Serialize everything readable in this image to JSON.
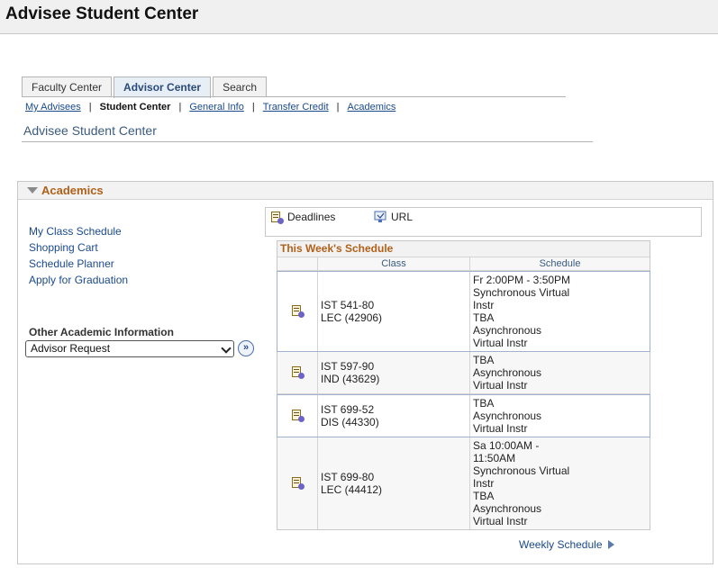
{
  "page": {
    "title": "Advisee Student Center"
  },
  "tabs": [
    {
      "label": "Faculty Center"
    },
    {
      "label": "Advisor Center"
    },
    {
      "label": "Search"
    }
  ],
  "subnav": {
    "items": [
      "My Advisees",
      "Student Center",
      "General Info",
      "Transfer Credit",
      "Academics"
    ],
    "separator": "|"
  },
  "content": {
    "heading": "Advisee Student Center"
  },
  "academics": {
    "header": "Academics",
    "links": [
      "My Class Schedule",
      "Shopping Cart",
      "Schedule Planner",
      "Apply for Graduation"
    ],
    "other_label": "Other Academic Information",
    "other_selected": "Advisor Request",
    "tools": {
      "deadlines": "Deadlines",
      "url": "URL"
    },
    "schedule": {
      "title": "This Week's Schedule",
      "col_class": "Class",
      "col_schedule": "Schedule",
      "rows": [
        {
          "class1": "IST 541-80",
          "class2": "LEC (42906)",
          "schedule": [
            "Fr 2:00PM - 3:50PM",
            "Synchronous Virtual",
            "Instr",
            "TBA",
            "Asynchronous",
            "Virtual Instr"
          ]
        },
        {
          "class1": "IST 597-90",
          "class2": "IND (43629)",
          "schedule": [
            "TBA",
            "Asynchronous",
            "Virtual Instr"
          ]
        },
        {
          "class1": "IST 699-52",
          "class2": "DIS (44330)",
          "schedule": [
            "TBA",
            "Asynchronous",
            "Virtual Instr"
          ]
        },
        {
          "class1": "IST 699-80",
          "class2": "LEC (44412)",
          "schedule": [
            "Sa 10:00AM -",
            "11:50AM",
            "Synchronous Virtual",
            "Instr",
            "TBA",
            "Asynchronous",
            "Virtual Instr"
          ]
        }
      ]
    },
    "weekly_link": "Weekly Schedule"
  }
}
